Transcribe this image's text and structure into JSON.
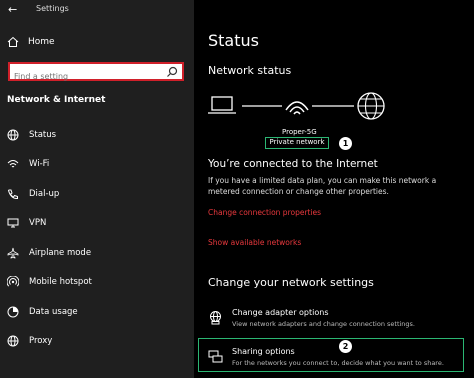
{
  "window": {
    "back_glyph": "←",
    "title": "Settings"
  },
  "sidebar": {
    "home_label": "Home",
    "search_placeholder": "Find a setting",
    "section_title": "Network & Internet",
    "items": [
      {
        "label": "Status",
        "icon": "globe-icon"
      },
      {
        "label": "Wi-Fi",
        "icon": "wifi-icon"
      },
      {
        "label": "Dial-up",
        "icon": "phone-icon"
      },
      {
        "label": "VPN",
        "icon": "vpn-icon"
      },
      {
        "label": "Airplane mode",
        "icon": "airplane-icon"
      },
      {
        "label": "Mobile hotspot",
        "icon": "hotspot-icon"
      },
      {
        "label": "Data usage",
        "icon": "data-usage-icon"
      },
      {
        "label": "Proxy",
        "icon": "globe-icon"
      }
    ]
  },
  "main": {
    "title": "Status",
    "network_status_heading": "Network status",
    "network_name": "Proper-5G",
    "network_type": "Private network",
    "badge_1": "1",
    "connected_heading": "You’re connected to the Internet",
    "connected_text": "If you have a limited data plan, you can make this network a metered connection or change other properties.",
    "link_change_properties": "Change connection properties",
    "link_show_networks": "Show available networks",
    "change_heading": "Change your network settings",
    "options": [
      {
        "title": "Change adapter options",
        "desc": "View network adapters and change connection settings."
      },
      {
        "title": "Sharing options",
        "desc": "For the networks you connect to, decide what you want to share."
      }
    ],
    "badge_2": "2"
  },
  "colors": {
    "accent_highlight": "#2bb673",
    "link": "#e8383d",
    "search_border": "#d0202a"
  }
}
